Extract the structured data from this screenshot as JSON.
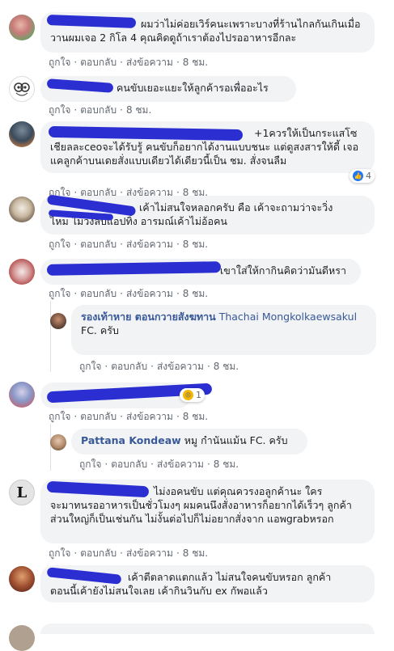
{
  "actions": {
    "like": "ถูกใจ",
    "reply": "ตอบกลับ",
    "translate": "ส่งข้อความ",
    "sep": "·"
  },
  "comments": [
    {
      "text_head": "ผมว่าไม่ค่อยเวิร์คนะเพราะบางที่ร้านไกลกันเกินเมื่อ",
      "text_tail": "วานผมเจอ 2 กิโล 4 คุณคิดดูถ้าเราต้องไปรออาหารอีกละ",
      "time": "8 ชม."
    },
    {
      "text": "คนขับเยอะแยะให้ลูกค้ารอเพื่ออะไร",
      "time": "8 ชม."
    },
    {
      "text_head": "+1ควรให้เป็นกระแสโซ",
      "text_tail": "เชียลละceoจะได้รับรู้ คนขับก็อยากได้งานแบบชนะ แต่ดูสงสารให้ดี้ เจอแคลูกค้าบนเดยสั่งแบบเดียวได้เดียวนี้เป็น ชม. สั่งจนลืม",
      "time": "8 ชม.",
      "reaction_count": "4"
    },
    {
      "text_head": "เค้าไม่สนใจหลอกครับ คือ เค้าจะถามว่าจะวิ่ง",
      "text_tail": "ไหม ไม่วิ่งลบแอปทิ้ง อารมณ์เค้าไม่อ้อคน",
      "time": "8 ชม."
    },
    {
      "text": "เขาใส่ให้กากินคิดว่ามันดีหรา",
      "time": "8 ชม."
    },
    {
      "reaction_count": "1",
      "time": "8 ชม."
    },
    {
      "text_head": "ไม่งอคนขับ แต่คุณควรงอลูกค้านะ ใคร",
      "text_tail": "จะมาทนรออาหารเป็นชั่วโมงๆ ผมคนนึงสั่งอาหารก็อยากได้เร็วๆ ลูกค้าส่วนใหญ่ก็เป็นเช่นกัน ไม่งั้นต่อไปก็ไม่อยากสั่งจาก แอพgrabหรอก",
      "time": "8 ชม."
    },
    {
      "text_head": "เค้าตีตลาดแตกแล้ว ไม่สนใจคนขับหรอก ลูกค้า",
      "text_tail": "ตอนนี้เค้ายังไม่สนใจเลย เค้ากินวินกับ ex กัพอแล้ว"
    }
  ],
  "replies": [
    {
      "name": "รองเท้าหาย ตอนกวายสังฆทาน",
      "name2": "Thachai Mongkolkaewsakul",
      "text": "FC. ครับ",
      "time": "8 ชม."
    },
    {
      "name": "Pattana Kondeaw",
      "text": "หมู กำนันแม้น FC. ครับ",
      "time": "8 ชม."
    }
  ],
  "colors": {
    "link": "#385898",
    "bubble": "#f2f3f5",
    "scribble": "#2b2fd1",
    "like_blue": "#2078f4"
  }
}
